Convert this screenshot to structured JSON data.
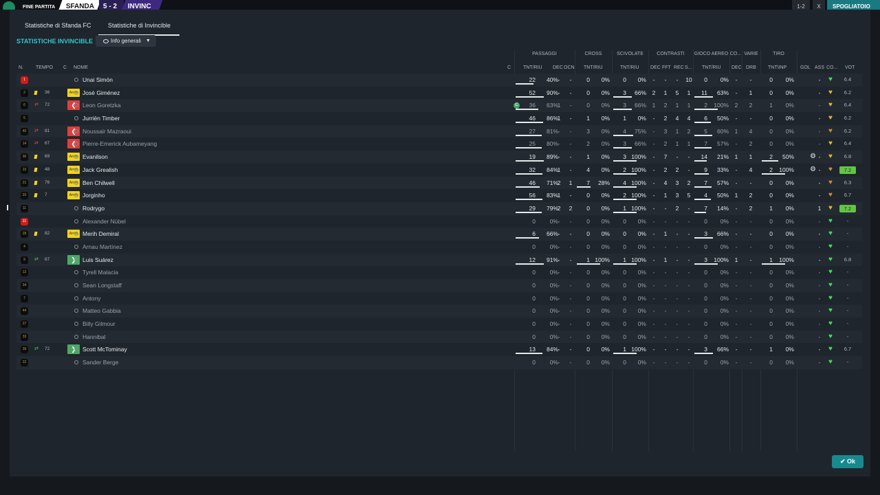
{
  "topbar": {
    "match_status": "FINE PARTITA",
    "home_team": "SFANDA",
    "score": "5 - 2",
    "away_team": "INVINC",
    "right_a": "1-2",
    "right_b": "X",
    "right_c": "SPOGLIATOIO"
  },
  "tabs": [
    "Statistiche di Sfanda FC",
    "Statistiche di Invincible"
  ],
  "section_title": "STATISTICHE INVINCIBLE",
  "view_dropdown": "Info generali",
  "column_groups": [
    "PASSAGGI",
    "CROSS",
    "SCIVOLATE",
    "CONTRASTI",
    "GIOCO AEREO",
    "CO...",
    "VARIE",
    "TIRO"
  ],
  "column_headers": {
    "num": "N.",
    "time": "TEMPO",
    "c": "C",
    "name": "NOME",
    "c2": "C",
    "pass_tnt": "TNT/RIU",
    "pass_dec": "DEC",
    "pass_ocn": "OCN",
    "cross_tnt": "TNT/RIU",
    "sciv_tnt": "TNT/RIU",
    "con_dec": "DEC",
    "con_fft": "FFT",
    "con_rec": "REC",
    "con_s": "S...",
    "aer_tnt": "TNT/RIU",
    "co_dec": "DEC",
    "var_drb": "DRB",
    "tiro_tnt": "TNT\\INP",
    "gol": "GOL",
    "ass": "ASS",
    "cond": "CO...",
    "vot": "VOT"
  },
  "players": [
    {
      "num": "1",
      "red": true,
      "time": "",
      "card": "",
      "sub": "",
      "name": "Unai Simón",
      "cap": false,
      "p": "22",
      "pp": "40%",
      "pd": "-",
      "po": "-",
      "cr": "0",
      "crp": "0%",
      "sc": "0",
      "scp": "0%",
      "cd": "-",
      "cf": "-",
      "crc": "-",
      "cs": "10",
      "ae": "0",
      "aep": "0%",
      "co": "-",
      "dr": "-",
      "t": "0",
      "tp": "0%",
      "gol": "",
      "ass": "-",
      "heart": "g",
      "vot": "6.4",
      "hl": false,
      "dim": false
    },
    {
      "num": "2",
      "red": false,
      "time": "36",
      "card": "yellow",
      "sub": "amm",
      "name": "José Giménez",
      "cap": false,
      "p": "52",
      "pp": "90%",
      "pd": "-",
      "po": "-",
      "cr": "0",
      "crp": "0%",
      "sc": "3",
      "scp": "66%",
      "cd": "2",
      "cf": "1",
      "crc": "5",
      "cs": "1",
      "ae": "11",
      "aep": "63%",
      "co": "-",
      "dr": "1",
      "t": "0",
      "tp": "0%",
      "gol": "",
      "ass": "-",
      "heart": "y",
      "vot": "6.2",
      "hl": false,
      "dim": false
    },
    {
      "num": "6",
      "red": false,
      "time": "72",
      "card": "out",
      "sub": "out",
      "name": "Leon Goretzka",
      "cap": true,
      "p": "36",
      "pp": "63%",
      "pd": "1",
      "po": "-",
      "cr": "0",
      "crp": "0%",
      "sc": "3",
      "scp": "66%",
      "cd": "1",
      "cf": "2",
      "crc": "1",
      "cs": "1",
      "ae": "2",
      "aep": "100%",
      "co": "2",
      "dr": "2",
      "t": "1",
      "tp": "0%",
      "gol": "",
      "ass": "-",
      "heart": "y",
      "vot": "6.4",
      "hl": false,
      "dim": true
    },
    {
      "num": "5",
      "red": false,
      "time": "",
      "card": "",
      "sub": "",
      "name": "Jurriën Timber",
      "cap": false,
      "p": "46",
      "pp": "86%",
      "pd": "1",
      "po": "-",
      "cr": "1",
      "crp": "0%",
      "sc": "1",
      "scp": "0%",
      "cd": "-",
      "cf": "2",
      "crc": "4",
      "cs": "4",
      "ae": "6",
      "aep": "50%",
      "co": "-",
      "dr": "-",
      "t": "0",
      "tp": "0%",
      "gol": "",
      "ass": "-",
      "heart": "y",
      "vot": "6.2",
      "hl": false,
      "dim": false
    },
    {
      "num": "40",
      "red": false,
      "time": "81",
      "card": "out",
      "sub": "out",
      "name": "Noussair Mazraoui",
      "cap": false,
      "p": "27",
      "pp": "81%",
      "pd": "-",
      "po": "-",
      "cr": "3",
      "crp": "0%",
      "sc": "4",
      "scp": "75%",
      "cd": "-",
      "cf": "3",
      "crc": "1",
      "cs": "2",
      "ae": "5",
      "aep": "60%",
      "co": "1",
      "dr": "4",
      "t": "0",
      "tp": "0%",
      "gol": "",
      "ass": "-",
      "heart": "o",
      "vot": "6.2",
      "hl": false,
      "dim": true
    },
    {
      "num": "14",
      "red": false,
      "time": "67",
      "card": "out",
      "sub": "out",
      "name": "Pierre-Emerick Aubameyang",
      "cap": false,
      "p": "25",
      "pp": "80%",
      "pd": "-",
      "po": "-",
      "cr": "2",
      "crp": "0%",
      "sc": "3",
      "scp": "66%",
      "cd": "-",
      "cf": "2",
      "crc": "1",
      "cs": "1",
      "ae": "7",
      "aep": "57%",
      "co": "-",
      "dr": "2",
      "t": "0",
      "tp": "0%",
      "gol": "",
      "ass": "-",
      "heart": "y",
      "vot": "6.4",
      "hl": false,
      "dim": true
    },
    {
      "num": "30",
      "red": false,
      "time": "69",
      "card": "yellow",
      "sub": "amm",
      "name": "Evanilson",
      "cap": false,
      "p": "19",
      "pp": "89%",
      "pd": "-",
      "po": "-",
      "cr": "1",
      "crp": "0%",
      "sc": "3",
      "scp": "100%",
      "cd": "-",
      "cf": "7",
      "crc": "-",
      "cs": "-",
      "ae": "14",
      "aep": "21%",
      "co": "1",
      "dr": "1",
      "t": "2",
      "tp": "50%",
      "gol": "gear",
      "ass": "-",
      "heart": "y",
      "vot": "6.8",
      "hl": false,
      "dim": false
    },
    {
      "num": "10",
      "red": false,
      "time": "48",
      "card": "yellow",
      "sub": "amm",
      "name": "Jack Grealish",
      "cap": false,
      "p": "32",
      "pp": "84%",
      "pd": "1",
      "po": "-",
      "cr": "4",
      "crp": "0%",
      "sc": "2",
      "scp": "100%",
      "cd": "-",
      "cf": "2",
      "crc": "2",
      "cs": "-",
      "ae": "9",
      "aep": "33%",
      "co": "-",
      "dr": "4",
      "t": "2",
      "tp": "100%",
      "gol": "gear",
      "ass": "-",
      "heart": "o",
      "vot": "7.2",
      "hl": true,
      "dim": false
    },
    {
      "num": "21",
      "red": false,
      "time": "76",
      "card": "yellow",
      "sub": "amm",
      "name": "Ben Chilwell",
      "cap": false,
      "p": "46",
      "pp": "71%",
      "pd": "2",
      "po": "1",
      "cr": "7",
      "crp": "28%",
      "sc": "4",
      "scp": "100%",
      "cd": "-",
      "cf": "4",
      "crc": "3",
      "cs": "2",
      "ae": "7",
      "aep": "57%",
      "co": "-",
      "dr": "-",
      "t": "0",
      "tp": "0%",
      "gol": "",
      "ass": "-",
      "heart": "o",
      "vot": "6.3",
      "hl": false,
      "dim": false
    },
    {
      "num": "20",
      "red": false,
      "time": "7",
      "card": "yellow",
      "sub": "amm",
      "name": "Jorginho",
      "cap": false,
      "p": "56",
      "pp": "83%",
      "pd": "1",
      "po": "-",
      "cr": "0",
      "crp": "0%",
      "sc": "2",
      "scp": "100%",
      "cd": "-",
      "cf": "1",
      "crc": "3",
      "cs": "5",
      "ae": "4",
      "aep": "50%",
      "co": "1",
      "dr": "2",
      "t": "0",
      "tp": "0%",
      "gol": "",
      "ass": "-",
      "heart": "o",
      "vot": "6.7",
      "hl": false,
      "dim": false
    },
    {
      "num": "11",
      "red": false,
      "time": "",
      "card": "",
      "sub": "",
      "name": "Rodrygo",
      "cap": false,
      "p": "29",
      "pp": "79%",
      "pd": "2",
      "po": "2",
      "cr": "0",
      "crp": "0%",
      "sc": "1",
      "scp": "100%",
      "cd": "-",
      "cf": "-",
      "crc": "2",
      "cs": "-",
      "ae": "7",
      "aep": "14%",
      "co": "-",
      "dr": "2",
      "t": "1",
      "tp": "0%",
      "gol": "",
      "ass": "1",
      "heart": "y",
      "vot": "7.2",
      "hl": true,
      "dim": false
    },
    {
      "num": "31",
      "red": true,
      "time": "",
      "card": "",
      "sub": "",
      "name": "Alexander Nübel",
      "cap": false,
      "p": "0",
      "pp": "0%",
      "pd": "-",
      "po": "-",
      "cr": "0",
      "crp": "0%",
      "sc": "0",
      "scp": "0%",
      "cd": "-",
      "cf": "-",
      "crc": "-",
      "cs": "-",
      "ae": "0",
      "aep": "0%",
      "co": "-",
      "dr": "-",
      "t": "0",
      "tp": "0%",
      "gol": "",
      "ass": "-",
      "heart": "g",
      "vot": "-",
      "hl": false,
      "dim": true
    },
    {
      "num": "28",
      "red": false,
      "time": "82",
      "card": "yellow",
      "sub": "amm",
      "name": "Merih Demiral",
      "cap": false,
      "p": "6",
      "pp": "66%",
      "pd": "-",
      "po": "-",
      "cr": "0",
      "crp": "0%",
      "sc": "0",
      "scp": "0%",
      "cd": "-",
      "cf": "1",
      "crc": "-",
      "cs": "-",
      "ae": "3",
      "aep": "66%",
      "co": "-",
      "dr": "-",
      "t": "0",
      "tp": "0%",
      "gol": "",
      "ass": "-",
      "heart": "g",
      "vot": "-",
      "hl": false,
      "dim": false
    },
    {
      "num": "4",
      "red": false,
      "time": "",
      "card": "",
      "sub": "",
      "name": "Arnau Martínez",
      "cap": false,
      "p": "0",
      "pp": "0%",
      "pd": "-",
      "po": "-",
      "cr": "0",
      "crp": "0%",
      "sc": "0",
      "scp": "0%",
      "cd": "-",
      "cf": "-",
      "crc": "-",
      "cs": "-",
      "ae": "0",
      "aep": "0%",
      "co": "-",
      "dr": "-",
      "t": "0",
      "tp": "0%",
      "gol": "",
      "ass": "-",
      "heart": "g",
      "vot": "-",
      "hl": false,
      "dim": true
    },
    {
      "num": "9",
      "red": false,
      "time": "67",
      "card": "in",
      "sub": "in",
      "name": "Luis Suárez",
      "cap": false,
      "p": "12",
      "pp": "91%",
      "pd": "-",
      "po": "-",
      "cr": "1",
      "crp": "100%",
      "sc": "1",
      "scp": "100%",
      "cd": "-",
      "cf": "1",
      "crc": "-",
      "cs": "-",
      "ae": "3",
      "aep": "100%",
      "co": "1",
      "dr": "-",
      "t": "1",
      "tp": "100%",
      "gol": "",
      "ass": "-",
      "heart": "g",
      "vot": "6.8",
      "hl": false,
      "dim": false
    },
    {
      "num": "12",
      "red": false,
      "time": "",
      "card": "",
      "sub": "",
      "name": "Tyrell Malacia",
      "cap": false,
      "p": "0",
      "pp": "0%",
      "pd": "-",
      "po": "-",
      "cr": "0",
      "crp": "0%",
      "sc": "0",
      "scp": "0%",
      "cd": "-",
      "cf": "-",
      "crc": "-",
      "cs": "-",
      "ae": "0",
      "aep": "0%",
      "co": "-",
      "dr": "-",
      "t": "0",
      "tp": "0%",
      "gol": "",
      "ass": "-",
      "heart": "g",
      "vot": "-",
      "hl": false,
      "dim": true
    },
    {
      "num": "34",
      "red": false,
      "time": "",
      "card": "",
      "sub": "",
      "name": "Sean Longstaff",
      "cap": false,
      "p": "0",
      "pp": "0%",
      "pd": "-",
      "po": "-",
      "cr": "0",
      "crp": "0%",
      "sc": "0",
      "scp": "0%",
      "cd": "-",
      "cf": "-",
      "crc": "-",
      "cs": "-",
      "ae": "0",
      "aep": "0%",
      "co": "-",
      "dr": "-",
      "t": "0",
      "tp": "0%",
      "gol": "",
      "ass": "-",
      "heart": "g",
      "vot": "-",
      "hl": false,
      "dim": true
    },
    {
      "num": "7",
      "red": false,
      "time": "",
      "card": "",
      "sub": "",
      "name": "Antony",
      "cap": false,
      "p": "0",
      "pp": "0%",
      "pd": "-",
      "po": "-",
      "cr": "0",
      "crp": "0%",
      "sc": "0",
      "scp": "0%",
      "cd": "-",
      "cf": "-",
      "crc": "-",
      "cs": "-",
      "ae": "0",
      "aep": "0%",
      "co": "-",
      "dr": "-",
      "t": "0",
      "tp": "0%",
      "gol": "",
      "ass": "-",
      "heart": "g",
      "vot": "-",
      "hl": false,
      "dim": true
    },
    {
      "num": "44",
      "red": false,
      "time": "",
      "card": "",
      "sub": "",
      "name": "Matteo Gabbia",
      "cap": false,
      "p": "0",
      "pp": "0%",
      "pd": "-",
      "po": "-",
      "cr": "0",
      "crp": "0%",
      "sc": "0",
      "scp": "0%",
      "cd": "-",
      "cf": "-",
      "crc": "-",
      "cs": "-",
      "ae": "0",
      "aep": "0%",
      "co": "-",
      "dr": "-",
      "t": "0",
      "tp": "0%",
      "gol": "",
      "ass": "-",
      "heart": "g",
      "vot": "-",
      "hl": false,
      "dim": true
    },
    {
      "num": "27",
      "red": false,
      "time": "",
      "card": "",
      "sub": "",
      "name": "Billy Gilmour",
      "cap": false,
      "p": "0",
      "pp": "0%",
      "pd": "-",
      "po": "-",
      "cr": "0",
      "crp": "0%",
      "sc": "0",
      "scp": "0%",
      "cd": "-",
      "cf": "-",
      "crc": "-",
      "cs": "-",
      "ae": "0",
      "aep": "0%",
      "co": "-",
      "dr": "-",
      "t": "0",
      "tp": "0%",
      "gol": "",
      "ass": "-",
      "heart": "g",
      "vot": "-",
      "hl": false,
      "dim": true
    },
    {
      "num": "33",
      "red": false,
      "time": "",
      "card": "",
      "sub": "",
      "name": "Hannibal",
      "cap": false,
      "p": "0",
      "pp": "0%",
      "pd": "-",
      "po": "-",
      "cr": "0",
      "crp": "0%",
      "sc": "0",
      "scp": "0%",
      "cd": "-",
      "cf": "-",
      "crc": "-",
      "cs": "-",
      "ae": "0",
      "aep": "0%",
      "co": "-",
      "dr": "-",
      "t": "0",
      "tp": "0%",
      "gol": "",
      "ass": "-",
      "heart": "g",
      "vot": "-",
      "hl": false,
      "dim": true
    },
    {
      "num": "39",
      "red": false,
      "time": "72",
      "card": "in",
      "sub": "in",
      "name": "Scott McTominay",
      "cap": false,
      "p": "13",
      "pp": "84%",
      "pd": "-",
      "po": "-",
      "cr": "0",
      "crp": "0%",
      "sc": "1",
      "scp": "100%",
      "cd": "-",
      "cf": "-",
      "crc": "-",
      "cs": "-",
      "ae": "3",
      "aep": "66%",
      "co": "-",
      "dr": "-",
      "t": "1",
      "tp": "0%",
      "gol": "",
      "ass": "-",
      "heart": "g",
      "vot": "6.7",
      "hl": false,
      "dim": false
    },
    {
      "num": "22",
      "red": false,
      "time": "",
      "card": "",
      "sub": "",
      "name": "Sander Berge",
      "cap": false,
      "p": "0",
      "pp": "0%",
      "pd": "-",
      "po": "-",
      "cr": "0",
      "crp": "0%",
      "sc": "0",
      "scp": "0%",
      "cd": "-",
      "cf": "-",
      "crc": "-",
      "cs": "-",
      "ae": "0",
      "aep": "0%",
      "co": "-",
      "dr": "-",
      "t": "0",
      "tp": "0%",
      "gol": "",
      "ass": "-",
      "heart": "g",
      "vot": "-",
      "hl": false,
      "dim": true
    }
  ],
  "labels": {
    "amm": "Amm",
    "ok": "Ok"
  },
  "colors": {
    "accent": "#2fc6d4",
    "ok_button": "#178a8f",
    "yellow_card": "#f2d21e",
    "sub_out": "#d9403e",
    "sub_in": "#4aa865",
    "rating_highlight": "#62c546"
  }
}
